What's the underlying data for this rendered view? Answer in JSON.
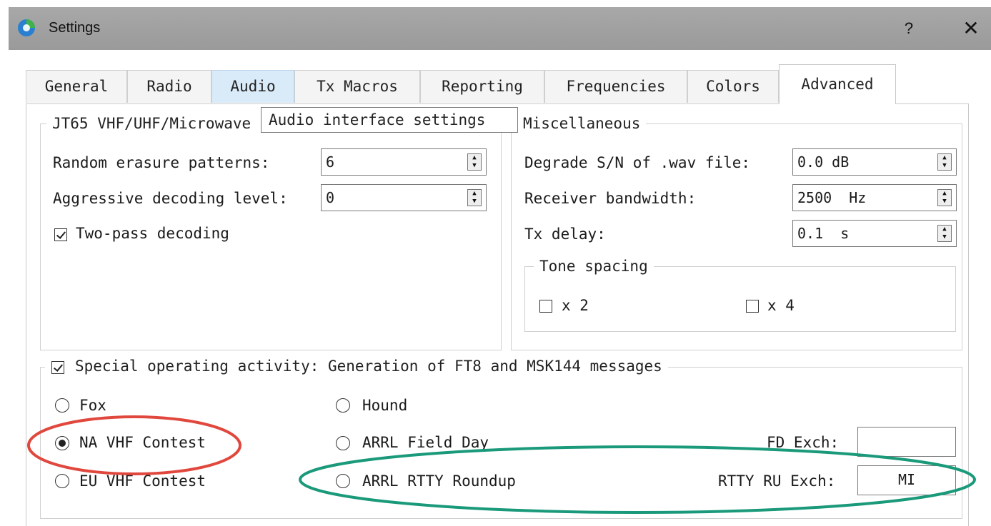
{
  "window": {
    "title": "Settings",
    "help_label": "?",
    "close_label": "✕"
  },
  "tabs": [
    {
      "label": "General"
    },
    {
      "label": "Radio"
    },
    {
      "label": "Audio"
    },
    {
      "label": "Tx Macros"
    },
    {
      "label": "Reporting"
    },
    {
      "label": "Frequencies"
    },
    {
      "label": "Colors"
    },
    {
      "label": "Advanced"
    }
  ],
  "tooltip": "Audio interface settings",
  "jt65": {
    "title": "JT65 VHF/UHF/Microwave decoding parameters",
    "random_erasure_label": "Random erasure patterns:",
    "random_erasure_value": "6",
    "aggressive_label": "Aggressive decoding level:",
    "aggressive_value": "0",
    "two_pass_label": "Two-pass decoding",
    "two_pass_checked": true
  },
  "misc": {
    "title": "Miscellaneous",
    "degrade_label": "Degrade S/N of .wav file:",
    "degrade_value": "0.0 dB",
    "bandwidth_label": "Receiver bandwidth:",
    "bandwidth_value": "2500  Hz",
    "txdelay_label": "Tx delay:",
    "txdelay_value": "0.1  s",
    "tone_spacing_title": "Tone spacing",
    "x2_label": "x 2",
    "x4_label": "x 4"
  },
  "special": {
    "title": "Special operating activity:  Generation of FT8 and MSK144 messages",
    "enabled": true,
    "fox": "Fox",
    "hound": "Hound",
    "na_vhf": "NA VHF Contest",
    "field_day": "ARRL Field Day",
    "eu_vhf": "EU VHF Contest",
    "rtty_roundup": "ARRL RTTY Roundup",
    "selected": "NA VHF Contest",
    "fd_exch_label": "FD Exch:",
    "fd_exch_value": "",
    "rtty_exch_label": "RTTY RU Exch:",
    "rtty_exch_value": "MI"
  },
  "colors": {
    "titlebar": "#9e9e9e",
    "tab_hover": "#d9eaf8",
    "annotation_red": "#e0473d",
    "annotation_green": "#1a9a7a"
  },
  "icons": [
    "app-icon",
    "help-icon",
    "close-icon",
    "spin-arrows-icon"
  ]
}
